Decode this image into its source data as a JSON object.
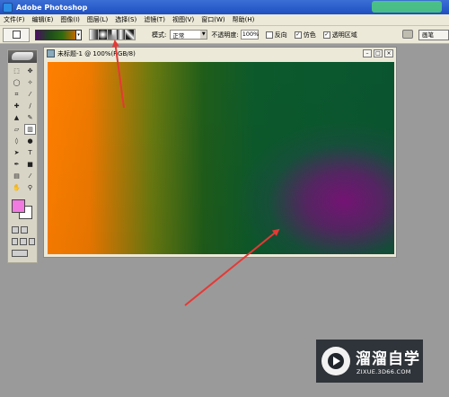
{
  "app": {
    "title": "Adobe Photoshop"
  },
  "menu": [
    "文件(F)",
    "编辑(E)",
    "图像(I)",
    "图层(L)",
    "选择(S)",
    "滤镜(T)",
    "视图(V)",
    "窗口(W)",
    "帮助(H)"
  ],
  "options": {
    "mode_label": "模式:",
    "mode_value": "正常",
    "opacity_label": "不透明度:",
    "opacity_value": "100%",
    "reverse_label": "反向",
    "reverse_checked": false,
    "dither_label": "仿色",
    "dither_checked": true,
    "transparency_label": "透明区域",
    "transparency_checked": true,
    "preset_label": "画笔"
  },
  "document": {
    "title": "未标题-1 @ 100%(RGB/8)"
  },
  "watermark": {
    "name": "溜溜自学",
    "url": "ZIXUE.3D66.COM"
  },
  "colors": {
    "foreground": "#f07ae0",
    "background": "#ffffff",
    "annotation_arrow": "#e53935"
  },
  "icons": [
    "photoshop-icon",
    "feather-icon",
    "marquee-icon",
    "move-icon",
    "lasso-icon",
    "magic-wand-icon",
    "crop-icon",
    "slice-icon",
    "healing-icon",
    "brush-icon",
    "stamp-icon",
    "history-brush-icon",
    "eraser-icon",
    "gradient-icon",
    "blur-icon",
    "dodge-icon",
    "path-select-icon",
    "type-icon",
    "pen-icon",
    "shape-icon",
    "notes-icon",
    "eyedropper-icon",
    "hand-icon",
    "zoom-icon"
  ]
}
